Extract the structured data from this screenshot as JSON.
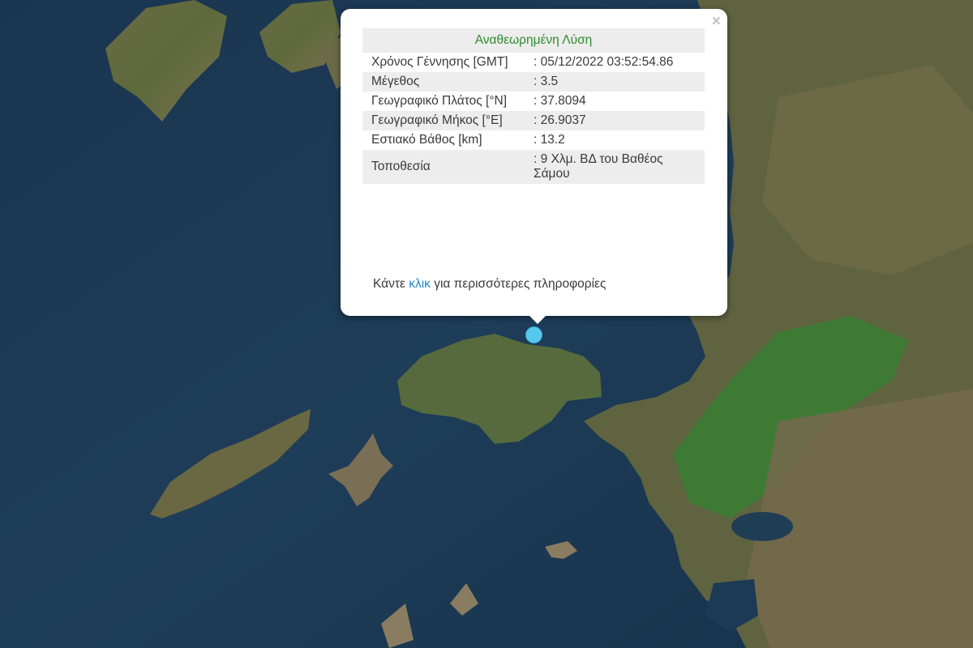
{
  "popup": {
    "title": "Αναθεωρημένη Λύση",
    "close_label": "×",
    "rows": [
      {
        "label": "Χρόνος Γέννησης [GMT]",
        "value": ": 05/12/2022 03:52:54.86"
      },
      {
        "label": "Μέγεθος",
        "value": ": 3.5"
      },
      {
        "label": "Γεωγραφικό Πλάτος [°N]",
        "value": ": 37.8094"
      },
      {
        "label": "Γεωγραφικό Μήκος [°E]",
        "value": ": 26.9037"
      },
      {
        "label": "Εστιακό Βάθος [km]",
        "value": ": 13.2"
      },
      {
        "label": "Τοποθεσία",
        "value": ": 9 Χλμ. ΒΔ του Βαθέος Σάμου"
      }
    ],
    "footer_prefix": "Κάντε ",
    "footer_link": "κλικ",
    "footer_suffix": " για περισσότερες πληροφορίες"
  },
  "colors": {
    "sea": "#1d3a52",
    "marker": "#55c8ec",
    "title_green": "#2e8b2e",
    "link_blue": "#1e88c7"
  }
}
